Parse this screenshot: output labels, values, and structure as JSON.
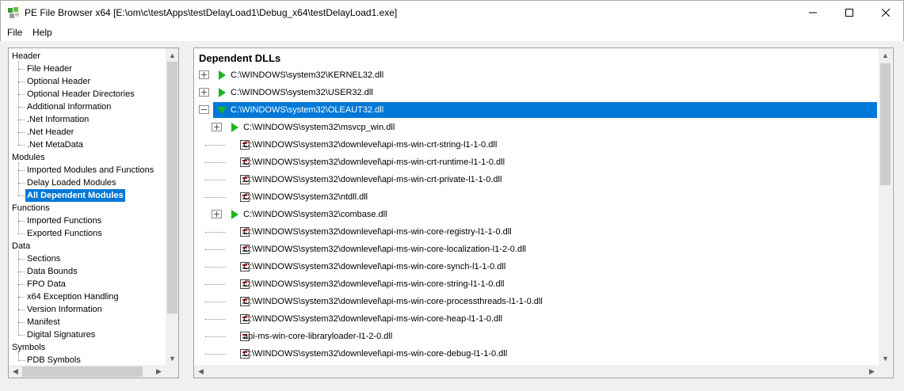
{
  "window": {
    "title": "PE File Browser x64 [E:\\om\\c\\testApps\\testDelayLoad1\\Debug_x64\\testDelayLoad1.exe]",
    "minimize_glyph": "—",
    "maximize_glyph": "☐",
    "close_glyph": "✕"
  },
  "menu": {
    "file": "File",
    "help": "Help"
  },
  "tree": [
    {
      "label": "Header",
      "level": 0
    },
    {
      "label": "File Header",
      "level": 1
    },
    {
      "label": "Optional Header",
      "level": 1
    },
    {
      "label": "Optional Header Directories",
      "level": 1
    },
    {
      "label": "Additional Information",
      "level": 1
    },
    {
      "label": ".Net Information",
      "level": 1
    },
    {
      "label": ".Net Header",
      "level": 1
    },
    {
      "label": ".Net MetaData",
      "level": 1
    },
    {
      "label": "Modules",
      "level": 0
    },
    {
      "label": "Imported Modules and Functions",
      "level": 1
    },
    {
      "label": "Delay Loaded Modules",
      "level": 1
    },
    {
      "label": "All Dependent Modules",
      "level": 1,
      "selected": true
    },
    {
      "label": "Functions",
      "level": 0
    },
    {
      "label": "Imported Functions",
      "level": 1
    },
    {
      "label": "Exported Functions",
      "level": 1
    },
    {
      "label": "Data",
      "level": 0
    },
    {
      "label": "Sections",
      "level": 1
    },
    {
      "label": "Data Bounds",
      "level": 1
    },
    {
      "label": "FPO Data",
      "level": 1
    },
    {
      "label": "x64 Exception Handling",
      "level": 1
    },
    {
      "label": "Version Information",
      "level": 1
    },
    {
      "label": "Manifest",
      "level": 1
    },
    {
      "label": "Digital Signatures",
      "level": 1
    },
    {
      "label": "Symbols",
      "level": 0
    },
    {
      "label": "PDB Symbols",
      "level": 1
    }
  ],
  "dependents": {
    "header": "Dependent DLLs",
    "rows": [
      {
        "path": "C:\\WINDOWS\\system32\\KERNEL32.dll",
        "level": 0,
        "expander": "plus",
        "icon": "play-right"
      },
      {
        "path": "C:\\WINDOWS\\system32\\USER32.dll",
        "level": 0,
        "expander": "plus",
        "icon": "play-right"
      },
      {
        "path": "C:\\WINDOWS\\system32\\OLEAUT32.dll",
        "level": 0,
        "expander": "minus",
        "icon": "play-down",
        "selected": true
      },
      {
        "path": "C:\\WINDOWS\\system32\\msvcp_win.dll",
        "level": 1,
        "expander": "plus",
        "icon": "play-right"
      },
      {
        "path": "C:\\WINDOWS\\system32\\downlevel\\api-ms-win-crt-string-l1-1-0.dll",
        "level": 1,
        "icon": "doc"
      },
      {
        "path": "C:\\WINDOWS\\system32\\downlevel\\api-ms-win-crt-runtime-l1-1-0.dll",
        "level": 1,
        "icon": "doc"
      },
      {
        "path": "C:\\WINDOWS\\system32\\downlevel\\api-ms-win-crt-private-l1-1-0.dll",
        "level": 1,
        "icon": "doc"
      },
      {
        "path": "C:\\WINDOWS\\system32\\ntdll.dll",
        "level": 1,
        "icon": "doc"
      },
      {
        "path": "C:\\WINDOWS\\system32\\combase.dll",
        "level": 1,
        "expander": "plus",
        "icon": "play-right"
      },
      {
        "path": "C:\\WINDOWS\\system32\\downlevel\\api-ms-win-core-registry-l1-1-0.dll",
        "level": 1,
        "icon": "doc"
      },
      {
        "path": "C:\\WINDOWS\\system32\\downlevel\\api-ms-win-core-localization-l1-2-0.dll",
        "level": 1,
        "icon": "doc"
      },
      {
        "path": "C:\\WINDOWS\\system32\\downlevel\\api-ms-win-core-synch-l1-1-0.dll",
        "level": 1,
        "icon": "doc"
      },
      {
        "path": "C:\\WINDOWS\\system32\\downlevel\\api-ms-win-core-string-l1-1-0.dll",
        "level": 1,
        "icon": "doc"
      },
      {
        "path": "C:\\WINDOWS\\system32\\downlevel\\api-ms-win-core-processthreads-l1-1-0.dll",
        "level": 1,
        "icon": "doc"
      },
      {
        "path": "C:\\WINDOWS\\system32\\downlevel\\api-ms-win-core-heap-l1-1-0.dll",
        "level": 1,
        "icon": "doc"
      },
      {
        "path": "api-ms-win-core-libraryloader-l1-2-0.dll",
        "level": 1,
        "icon": "doc"
      },
      {
        "path": "C:\\WINDOWS\\system32\\downlevel\\api-ms-win-core-debug-l1-1-0.dll",
        "level": 1,
        "icon": "doc"
      }
    ]
  },
  "colors": {
    "selection": "#0078d7",
    "play_icon": "#1bb520"
  }
}
